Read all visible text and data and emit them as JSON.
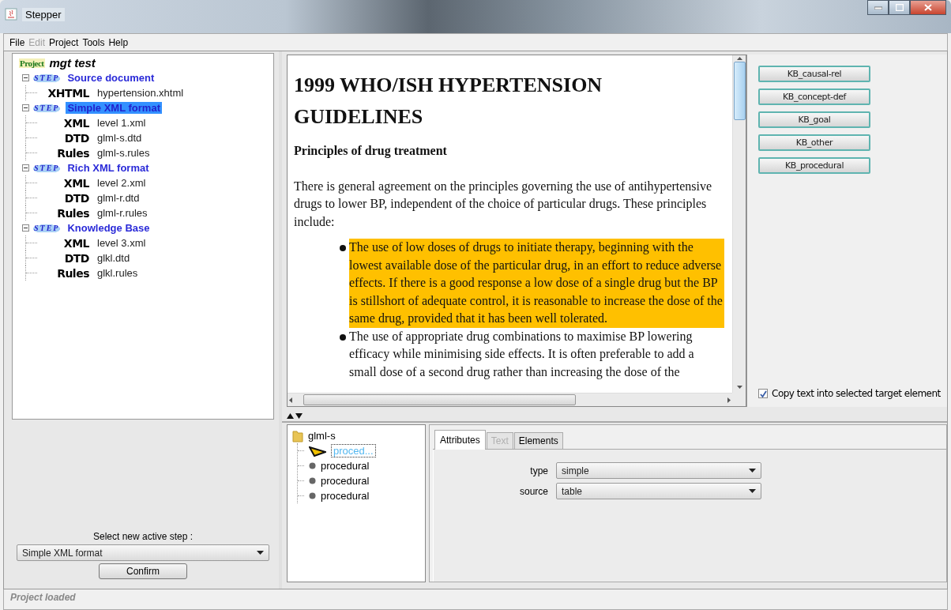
{
  "window": {
    "title": "Stepper"
  },
  "menu": [
    {
      "label": "File",
      "disabled": false
    },
    {
      "label": "Edit",
      "disabled": true
    },
    {
      "label": "Project",
      "disabled": false
    },
    {
      "label": "Tools",
      "disabled": false
    },
    {
      "label": "Help",
      "disabled": false
    }
  ],
  "project_tree": {
    "root": {
      "logo": "Project",
      "label": "mgt  test"
    },
    "steps": [
      {
        "logo": "STEP",
        "label": "Source document",
        "expanded": true,
        "selected": false,
        "files": [
          {
            "type": "XHTML",
            "name": "hypertension.xhtml"
          }
        ]
      },
      {
        "logo": "STEP",
        "label": "Simple XML format",
        "expanded": true,
        "selected": true,
        "files": [
          {
            "type": "XML",
            "name": "level 1.xml"
          },
          {
            "type": "DTD",
            "name": "glml-s.dtd"
          },
          {
            "type": "Rules",
            "name": "glml-s.rules"
          }
        ]
      },
      {
        "logo": "STEP",
        "label": "Rich XML format",
        "expanded": true,
        "selected": false,
        "files": [
          {
            "type": "XML",
            "name": "level 2.xml"
          },
          {
            "type": "DTD",
            "name": "glml-r.dtd"
          },
          {
            "type": "Rules",
            "name": "glml-r.rules"
          }
        ]
      },
      {
        "logo": "STEP",
        "label": "Knowledge Base",
        "expanded": true,
        "selected": false,
        "files": [
          {
            "type": "XML",
            "name": "level 3.xml"
          },
          {
            "type": "DTD",
            "name": "glkl.dtd"
          },
          {
            "type": "Rules",
            "name": "glkl.rules"
          }
        ]
      }
    ]
  },
  "step_selector": {
    "label": "Select new active step :",
    "value": "Simple XML format",
    "button": "Confirm"
  },
  "document": {
    "title": "1999 WHO/ISH HYPERTENSION GUIDELINES",
    "blocks": [
      {
        "kind": "subheading",
        "text": "Principles of drug treatment"
      },
      {
        "kind": "paragraph",
        "text": "There is general agreement on the principles governing the use of antihypertensive drugs to lower BP, independent of the choice of particular drugs. These principles include:"
      },
      {
        "kind": "bullet",
        "highlighted": true,
        "text": "The use of low doses of drugs to initiate therapy, beginning with the lowest available dose of the particular drug, in an effort to reduce adverse effects. If there is a good response a low dose of a single drug but the BP is stillshort of adequate control, it is reasonable to increase the dose of the same drug, provided that it has been well tolerated."
      },
      {
        "kind": "bullet",
        "highlighted": false,
        "text": "The use of appropriate drug combinations to maximise BP lowering efficacy while minimising side effects. It is often preferable to add a small dose of a second drug rather than increasing the dose of the"
      }
    ]
  },
  "kb_buttons": [
    "KB_causal-rel",
    "KB_concept-def",
    "KB_goal",
    "KB_other",
    "KB_procedural"
  ],
  "copy_option": {
    "label": "Copy text into selected target element",
    "checked": true
  },
  "element_tree": {
    "root": "glml-s",
    "children": [
      {
        "label": "proced...",
        "selected": true
      },
      {
        "label": "procedural",
        "selected": false
      },
      {
        "label": "procedural",
        "selected": false
      },
      {
        "label": "procedural",
        "selected": false
      }
    ]
  },
  "tabs": [
    {
      "label": "Attributes",
      "selected": true,
      "disabled": false
    },
    {
      "label": "Text",
      "selected": false,
      "disabled": true
    },
    {
      "label": "Elements",
      "selected": false,
      "disabled": false
    }
  ],
  "attributes": [
    {
      "name": "type",
      "value": "simple"
    },
    {
      "name": "source",
      "value": "table"
    }
  ],
  "status_bar": {
    "text": "Project loaded"
  }
}
